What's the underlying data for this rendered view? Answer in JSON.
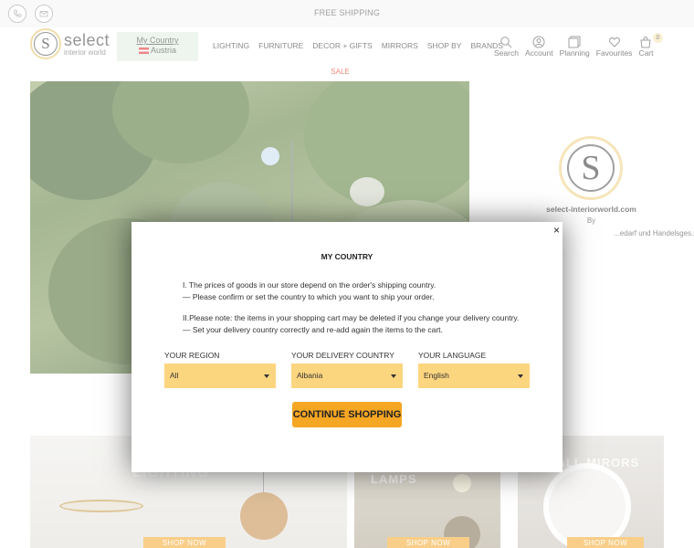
{
  "topbar": {
    "shipping": "FREE SHIPPING"
  },
  "brand": {
    "name": "select",
    "tagline": "interior world"
  },
  "country_switch": {
    "label": "My Country",
    "country": "Austria"
  },
  "nav": [
    "LIGHTING",
    "FURNITURE",
    "DECOR + GIFTS",
    "MIRRORS",
    "SHOP BY",
    "BRANDS"
  ],
  "header_icons": {
    "search": "Search",
    "account": "Account",
    "planning": "Planning",
    "favourites": "Favourites",
    "cart": "Cart",
    "cart_count": "0"
  },
  "sale": "SALE",
  "aside": {
    "domain": "select-interiorworld.com",
    "by": "By",
    "company": "...edarf und Handelsges.m.b.H."
  },
  "tiles": [
    {
      "title": "LIGHTING",
      "cta": "SHOP NOW"
    },
    {
      "title": "LAMPS",
      "cta": "SHOP NOW"
    },
    {
      "title": "WALL MIRORS",
      "cta": "SHOP NOW"
    }
  ],
  "modal": {
    "title": "MY COUNTRY",
    "p1_line1": "I. The prices of goods in our store depend on the order's shipping country.",
    "p1_line2": "— Please confirm or set the country to which you want to ship your order.",
    "p2_line1": "II.Please note: the items in your shopping cart may be deleted if you change your delivery country.",
    "p2_line2": "— Set your delivery country correctly and re-add again the items to the cart.",
    "region_label": "YOUR REGION",
    "region_value": "All",
    "delivery_label": "YOUR DELIVERY COUNTRY",
    "delivery_value": "Albania",
    "language_label": "YOUR LANGUAGE",
    "language_value": "English",
    "continue": "CONTINUE SHOPPING",
    "close": "×"
  },
  "colors": {
    "accent": "#f5a623",
    "select_bg": "#fcd57f",
    "sale": "#e0402a",
    "gold": "#e8c878"
  }
}
